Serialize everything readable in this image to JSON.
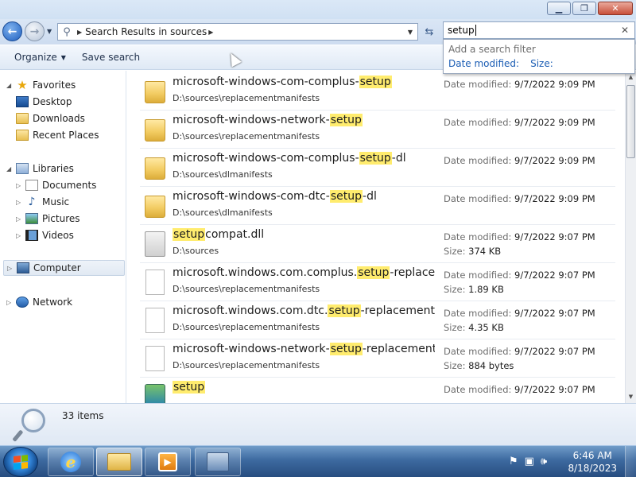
{
  "window": {
    "minimize_icon": "minimize-icon",
    "maximize_icon": "restore-icon",
    "close_icon": "close-icon"
  },
  "navbar": {
    "address_crumb": "Search Results in sources",
    "search_value": "setup"
  },
  "toolbar": {
    "organize_label": "Organize",
    "save_search_label": "Save search"
  },
  "filter_popup": {
    "hint": "Add a search filter",
    "date_modified_link": "Date modified:",
    "size_link": "Size:"
  },
  "navpane": {
    "favorites": "Favorites",
    "desktop": "Desktop",
    "downloads": "Downloads",
    "recent_places": "Recent Places",
    "libraries": "Libraries",
    "documents": "Documents",
    "music": "Music",
    "pictures": "Pictures",
    "videos": "Videos",
    "computer": "Computer",
    "network": "Network"
  },
  "meta_labels": {
    "date_modified": "Date modified:",
    "size": "Size:"
  },
  "results": [
    {
      "pre": "microsoft-windows-com-complus-",
      "hit": "setup",
      "post": "",
      "path": "D:\\sources\\replacementmanifests",
      "date": "9/7/2022 9:09 PM",
      "size": "",
      "type": "folder"
    },
    {
      "pre": "microsoft-windows-network-",
      "hit": "setup",
      "post": "",
      "path": "D:\\sources\\replacementmanifests",
      "date": "9/7/2022 9:09 PM",
      "size": "",
      "type": "folder"
    },
    {
      "pre": "microsoft-windows-com-complus-",
      "hit": "setup",
      "post": "-dl",
      "path": "D:\\sources\\dlmanifests",
      "date": "9/7/2022 9:09 PM",
      "size": "",
      "type": "folder"
    },
    {
      "pre": "microsoft-windows-com-dtc-",
      "hit": "setup",
      "post": "-dl",
      "path": "D:\\sources\\dlmanifests",
      "date": "9/7/2022 9:09 PM",
      "size": "",
      "type": "folder"
    },
    {
      "pre": "",
      "hit": "setup",
      "post": "compat.dll",
      "path": "D:\\sources",
      "date": "9/7/2022 9:07 PM",
      "size": "374 KB",
      "type": "dll"
    },
    {
      "pre": "microsoft.windows.com.complus.",
      "hit": "setup",
      "post": "-replace...",
      "path": "D:\\sources\\replacementmanifests",
      "date": "9/7/2022 9:07 PM",
      "size": "1.89 KB",
      "type": "file"
    },
    {
      "pre": "microsoft.windows.com.dtc.",
      "hit": "setup",
      "post": "-replacement....",
      "path": "D:\\sources\\replacementmanifests",
      "date": "9/7/2022 9:07 PM",
      "size": "4.35 KB",
      "type": "file"
    },
    {
      "pre": "microsoft-windows-network-",
      "hit": "setup",
      "post": "-replacement...",
      "path": "D:\\sources\\replacementmanifests",
      "date": "9/7/2022 9:07 PM",
      "size": "884 bytes",
      "type": "file"
    },
    {
      "pre": "",
      "hit": "setup",
      "post": "",
      "path": "",
      "date": "9/7/2022 9:07 PM",
      "size": "",
      "type": "exe"
    }
  ],
  "details": {
    "item_count": "33 items"
  },
  "taskbar": {
    "time": "6:46 AM",
    "date": "8/18/2023",
    "ie_glyph": "e"
  }
}
